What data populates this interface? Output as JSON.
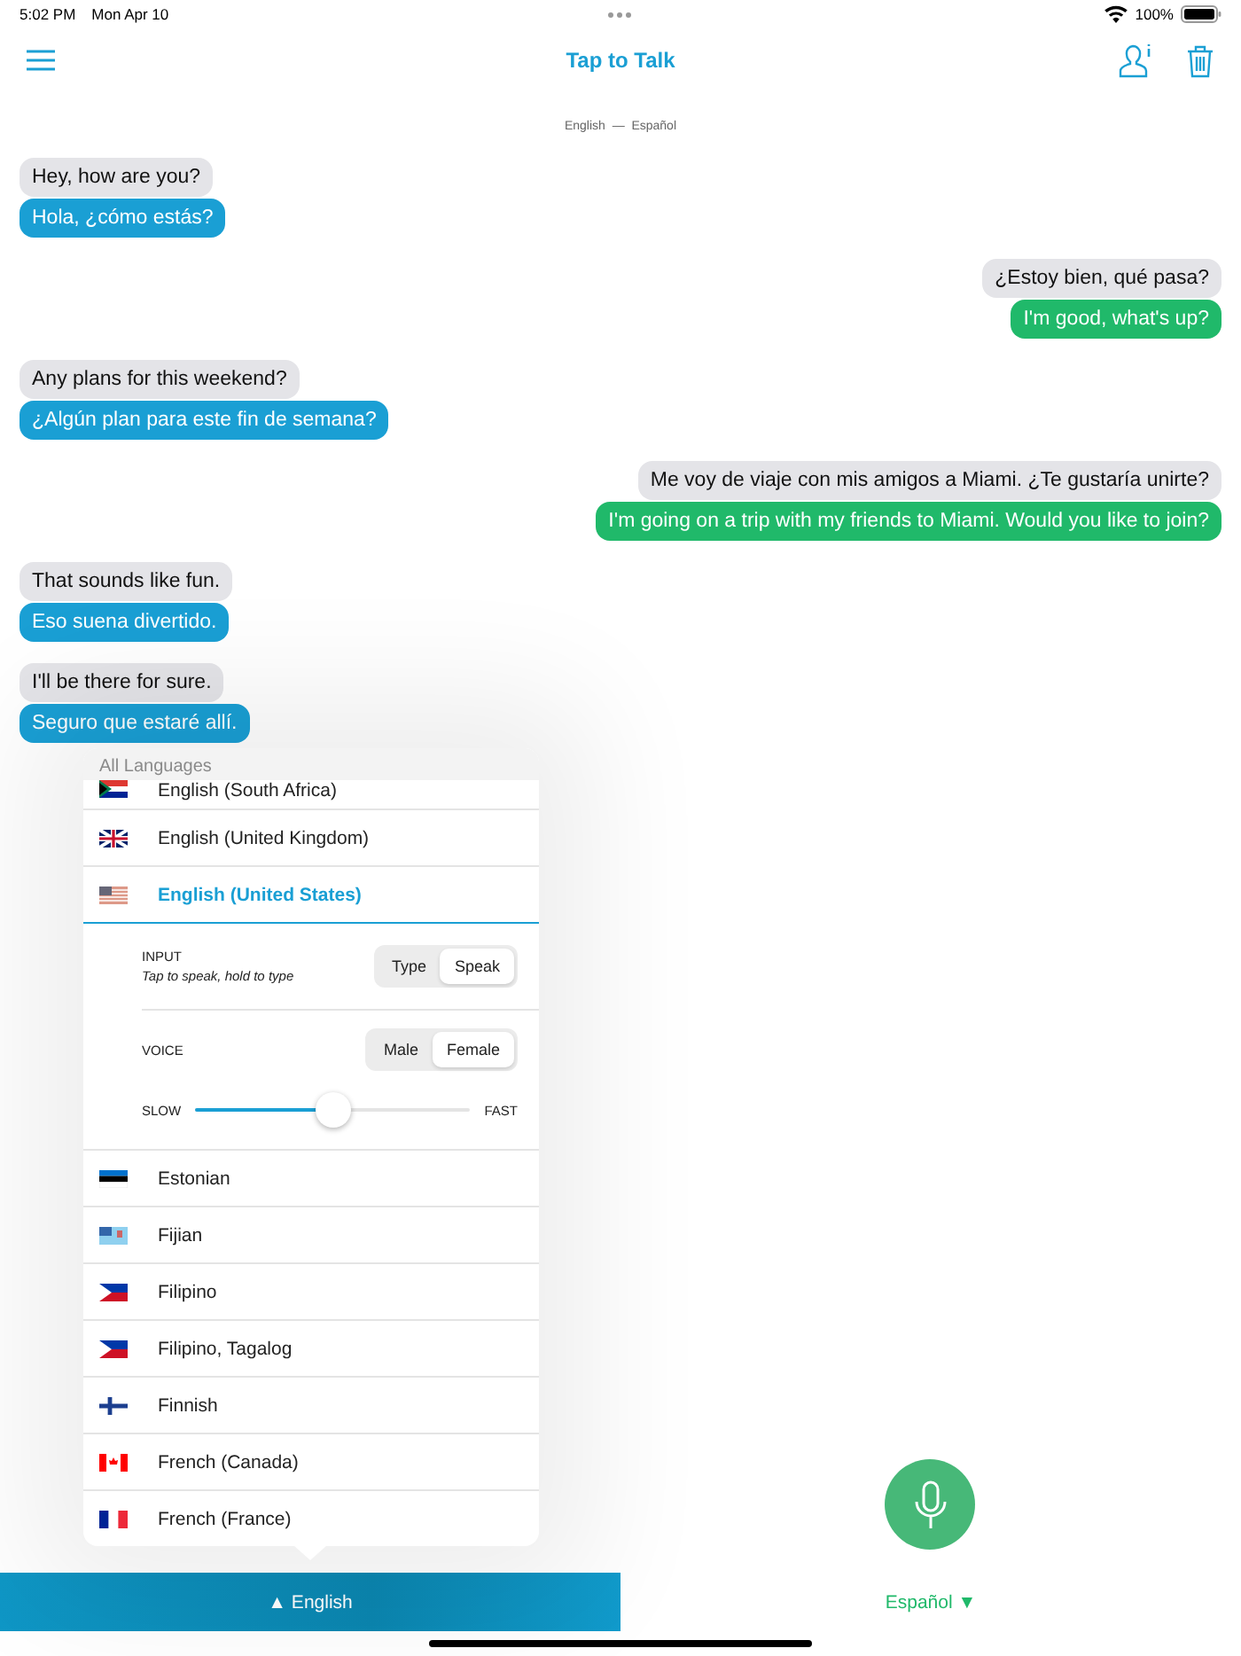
{
  "status_bar": {
    "time": "5:02 PM",
    "date": "Mon Apr 10",
    "battery": "100%"
  },
  "nav": {
    "title": "Tap to Talk"
  },
  "language_pair": "English  —  Español",
  "messages": [
    {
      "kind": "left",
      "original": "Hey, how are you?",
      "translation": "Hola, ¿cómo estás?"
    },
    {
      "kind": "right",
      "original": "¿Estoy bien, qué pasa?",
      "translation": "I'm good, what's up?"
    },
    {
      "kind": "left",
      "original": "Any plans for this weekend?",
      "translation": "¿Algún plan para este fin de semana?"
    },
    {
      "kind": "right",
      "original": "Me voy de viaje con mis amigos a Miami. ¿Te gustaría unirte?",
      "translation": "I'm going on a trip with my friends to Miami. Would you like to join?"
    },
    {
      "kind": "left",
      "original": "That sounds like fun.",
      "translation": "Eso suena divertido."
    },
    {
      "kind": "left",
      "original": "I'll be there for sure.",
      "translation": "Seguro que estaré allí."
    }
  ],
  "language_picker": {
    "header": "All Languages",
    "languages": [
      {
        "name": "English (South Africa)",
        "kind": "za",
        "selected": false
      },
      {
        "name": "English (United Kingdom)",
        "kind": "gb",
        "selected": false
      },
      {
        "name": "English (United States)",
        "kind": "us",
        "selected": true
      },
      {
        "name": "Estonian",
        "kind": "ee",
        "selected": false
      },
      {
        "name": "Fijian",
        "kind": "fj",
        "selected": false
      },
      {
        "name": "Filipino",
        "kind": "ph",
        "selected": false
      },
      {
        "name": "Filipino, Tagalog",
        "kind": "ph",
        "selected": false
      },
      {
        "name": "Finnish",
        "kind": "fi",
        "selected": false
      },
      {
        "name": "French (Canada)",
        "kind": "ca",
        "selected": false
      },
      {
        "name": "French (France)",
        "kind": "fr",
        "selected": false
      }
    ],
    "input": {
      "label": "INPUT",
      "hint": "Tap to speak, hold to type",
      "options": [
        {
          "label": "Type",
          "selected": false
        },
        {
          "label": "Speak",
          "selected": true
        }
      ]
    },
    "voice": {
      "label": "VOICE",
      "options": [
        {
          "label": "Male",
          "selected": false
        },
        {
          "label": "Female",
          "selected": true
        }
      ]
    },
    "speed": {
      "slow": "SLOW",
      "fast": "FAST",
      "level": 0.5
    }
  },
  "bottom_bar": [
    {
      "label": "▲ English",
      "selected": true
    },
    {
      "label": "Español ▼",
      "selected": false
    }
  ]
}
